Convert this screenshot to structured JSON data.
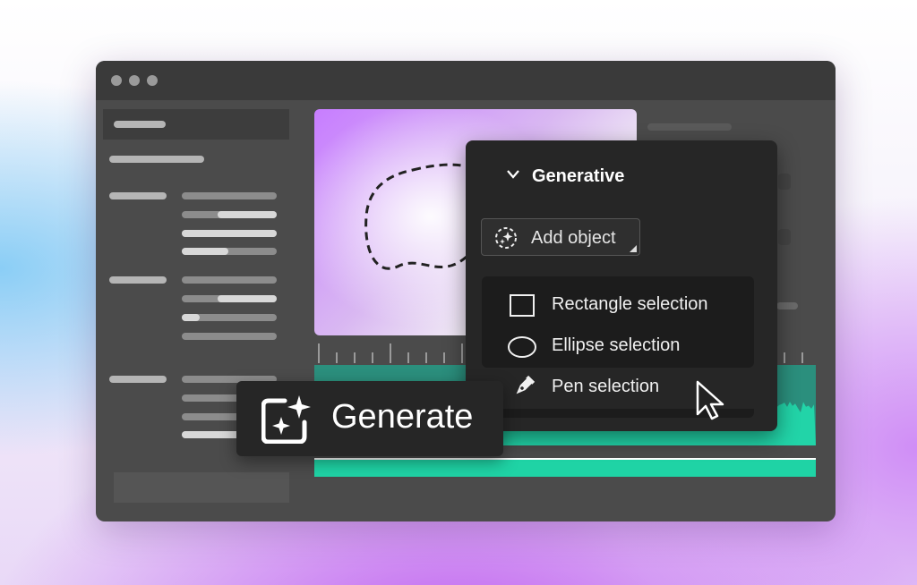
{
  "window": {
    "controls": [
      "window-dot",
      "window-dot",
      "window-dot"
    ]
  },
  "panel": {
    "section_title": "Generative",
    "add_object_label": "Add object",
    "menu_items": [
      {
        "label": "Rectangle selection",
        "icon": "rectangle-icon"
      },
      {
        "label": "Ellipse selection",
        "icon": "ellipse-icon"
      },
      {
        "label": "Pen selection",
        "icon": "pen-icon"
      }
    ]
  },
  "generate_button": {
    "label": "Generate",
    "icon": "generate-sparkle-icon"
  },
  "colors": {
    "window_bg": "#4b4b4b",
    "panel_bg": "#262626",
    "track_teal": "#22c9a2",
    "accent_purple": "#c77dff"
  }
}
